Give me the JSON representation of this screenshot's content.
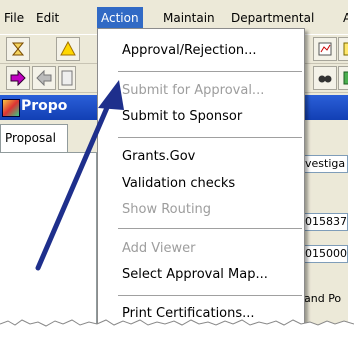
{
  "menubar": {
    "items": [
      "File",
      "Edit",
      "Action",
      "Maintain",
      "Departmental",
      "A"
    ],
    "active": "Action"
  },
  "window": {
    "title": "Propo"
  },
  "tabs": {
    "proposal": "Proposal"
  },
  "right_pane": {
    "items": [
      "vestiga",
      "015837",
      "015000:",
      "and Po"
    ]
  },
  "action_menu": {
    "items": [
      {
        "label": "Approval/Rejection...",
        "enabled": true
      },
      {
        "label": "Submit for Approval...",
        "enabled": false
      },
      {
        "label": "Submit to Sponsor",
        "enabled": true
      },
      {
        "label": "Grants.Gov",
        "enabled": true
      },
      {
        "label": "Validation checks",
        "enabled": true
      },
      {
        "label": "Show Routing",
        "enabled": false
      },
      {
        "label": "Add Viewer",
        "enabled": false
      },
      {
        "label": "Select Approval Map...",
        "enabled": true
      },
      {
        "label": "Print Certifications...",
        "enabled": true
      }
    ]
  },
  "colors": {
    "menu_highlight": "#316ac5",
    "title_bar": "#1f4fc8",
    "annotation_arrow": "#1e2f8c",
    "window_bg": "#ece9d8"
  },
  "icons": {
    "toolbar1": [
      "hourglass-icon",
      "warning-icon",
      "report-icon"
    ],
    "toolbar2": [
      "forward-arrow-icon",
      "back-arrow-icon",
      "doc-icon",
      "search-icon"
    ]
  }
}
